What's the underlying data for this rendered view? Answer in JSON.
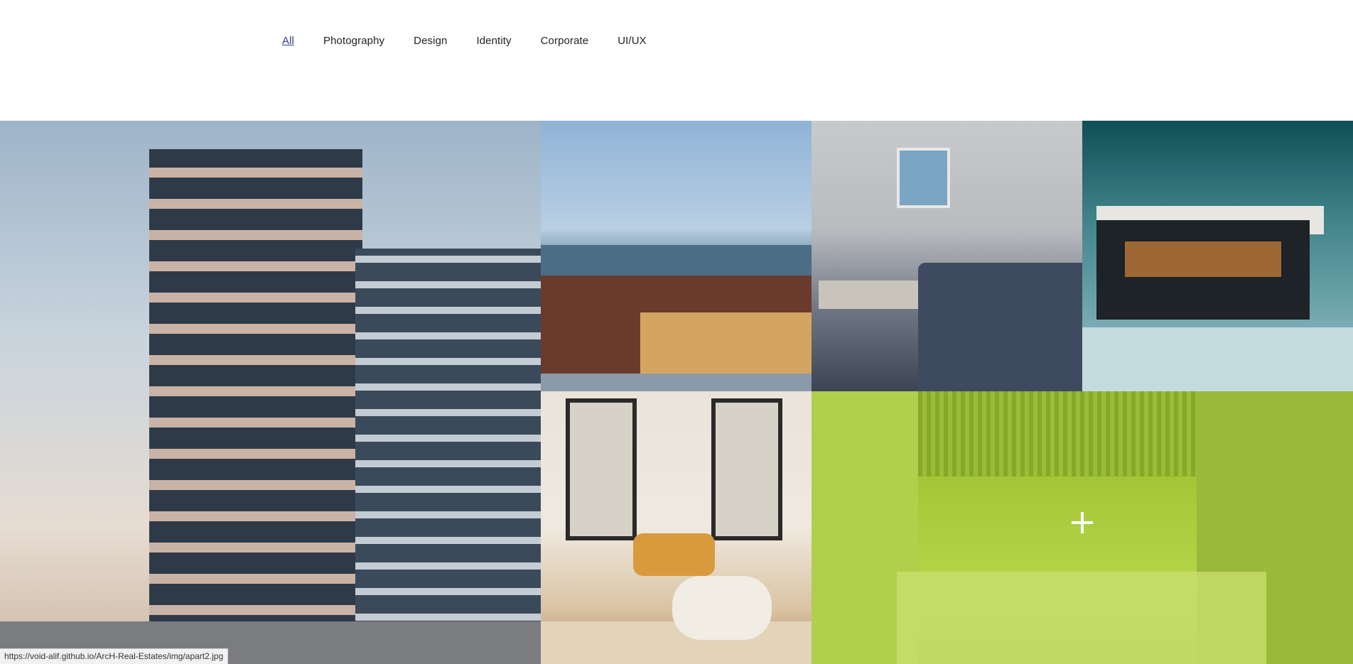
{
  "filters": {
    "items": [
      {
        "label": "All",
        "active": true
      },
      {
        "label": "Photography",
        "active": false
      },
      {
        "label": "Design",
        "active": false
      },
      {
        "label": "Identity",
        "active": false
      },
      {
        "label": "Corporate",
        "active": false
      },
      {
        "label": "UI/UX",
        "active": false
      }
    ]
  },
  "gallery": {
    "tiles": [
      {
        "subject": "high-rise apartment building at dusk"
      },
      {
        "subject": "brick building with glass entrance"
      },
      {
        "subject": "living room with grey sofa"
      },
      {
        "subject": "modern house with snow"
      },
      {
        "subject": "bright living room with orange chair"
      },
      {
        "subject": "wooden hallway interior",
        "hover_overlay_color": "#a4c83a",
        "hover_icon": "plus-icon"
      }
    ]
  },
  "status_bar": {
    "url": "https://void-alif.github.io/ArcH-Real-Estates/img/apart2.jpg"
  },
  "colors": {
    "active_filter": "#2c3e8c",
    "overlay": "#a4c83a"
  }
}
